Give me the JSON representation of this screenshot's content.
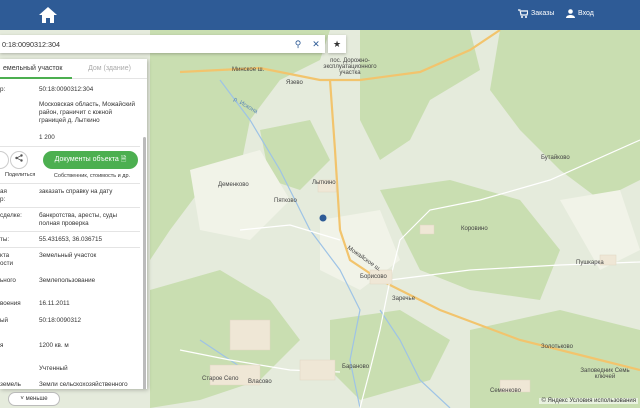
{
  "header": {
    "orders_label": "Заказы",
    "login_label": "Вход"
  },
  "search": {
    "value": "0:18:0090312:304"
  },
  "panel": {
    "tab_parcel": "емельный участок",
    "tab_building": "Дом (здание)",
    "rows": [
      {
        "k": "р:",
        "v": "50:18:0090312:304",
        "link": true
      },
      {
        "k": "",
        "v": "Московская область, Можайский район, граничит с южной границей д. Лыткино",
        "link": false
      },
      {
        "k": "",
        "v": "1 200",
        "link": false
      }
    ],
    "share_label": "Поделиться",
    "docs_button": "Документы объекта",
    "docs_sub": "Собственник, стоимость и др.",
    "details": [
      {
        "k": "ая\nр:",
        "v": "заказать справку на дату",
        "link": true
      },
      {
        "k": "сделке:",
        "v": "банкротства, аресты, суды",
        "link2": "полная проверка"
      },
      {
        "k": "ты:",
        "v": "55.431653, 36.036715"
      },
      {
        "k": "кта\nости",
        "v": "Земельный участок"
      },
      {
        "k": "ьного",
        "v": "Землепользование"
      },
      {
        "k": "воения",
        "v": "16.11.2011"
      },
      {
        "k": "ый",
        "v": "50:18:0090312"
      },
      {
        "k": "я",
        "v": "1200 кв. м"
      },
      {
        "k": "",
        "v": "Учтенный"
      },
      {
        "k": "земель",
        "v": "Земли сельскохозяйственного"
      }
    ]
  },
  "map": {
    "toggle_label": "меньше",
    "copyright": "© Яндекс Условия использования",
    "places": [
      {
        "name": "Язево"
      },
      {
        "name": "Лыткино"
      },
      {
        "name": "Пятково"
      },
      {
        "name": "Деменково"
      },
      {
        "name": "Борисово"
      },
      {
        "name": "Заречье"
      },
      {
        "name": "Коровино"
      },
      {
        "name": "Бутайково"
      },
      {
        "name": "Пушкарка"
      },
      {
        "name": "Золотьково"
      },
      {
        "name": "Семенково"
      },
      {
        "name": "Бараново"
      },
      {
        "name": "Власово"
      },
      {
        "name": "Старое Село"
      },
      {
        "name": "пос. Дорожно-эксплуатационного участка"
      },
      {
        "name": "Заповедник Семь ключей"
      },
      {
        "name": "Минское ш."
      },
      {
        "name": "Можайское ш."
      },
      {
        "name": "р. Искона"
      }
    ]
  }
}
